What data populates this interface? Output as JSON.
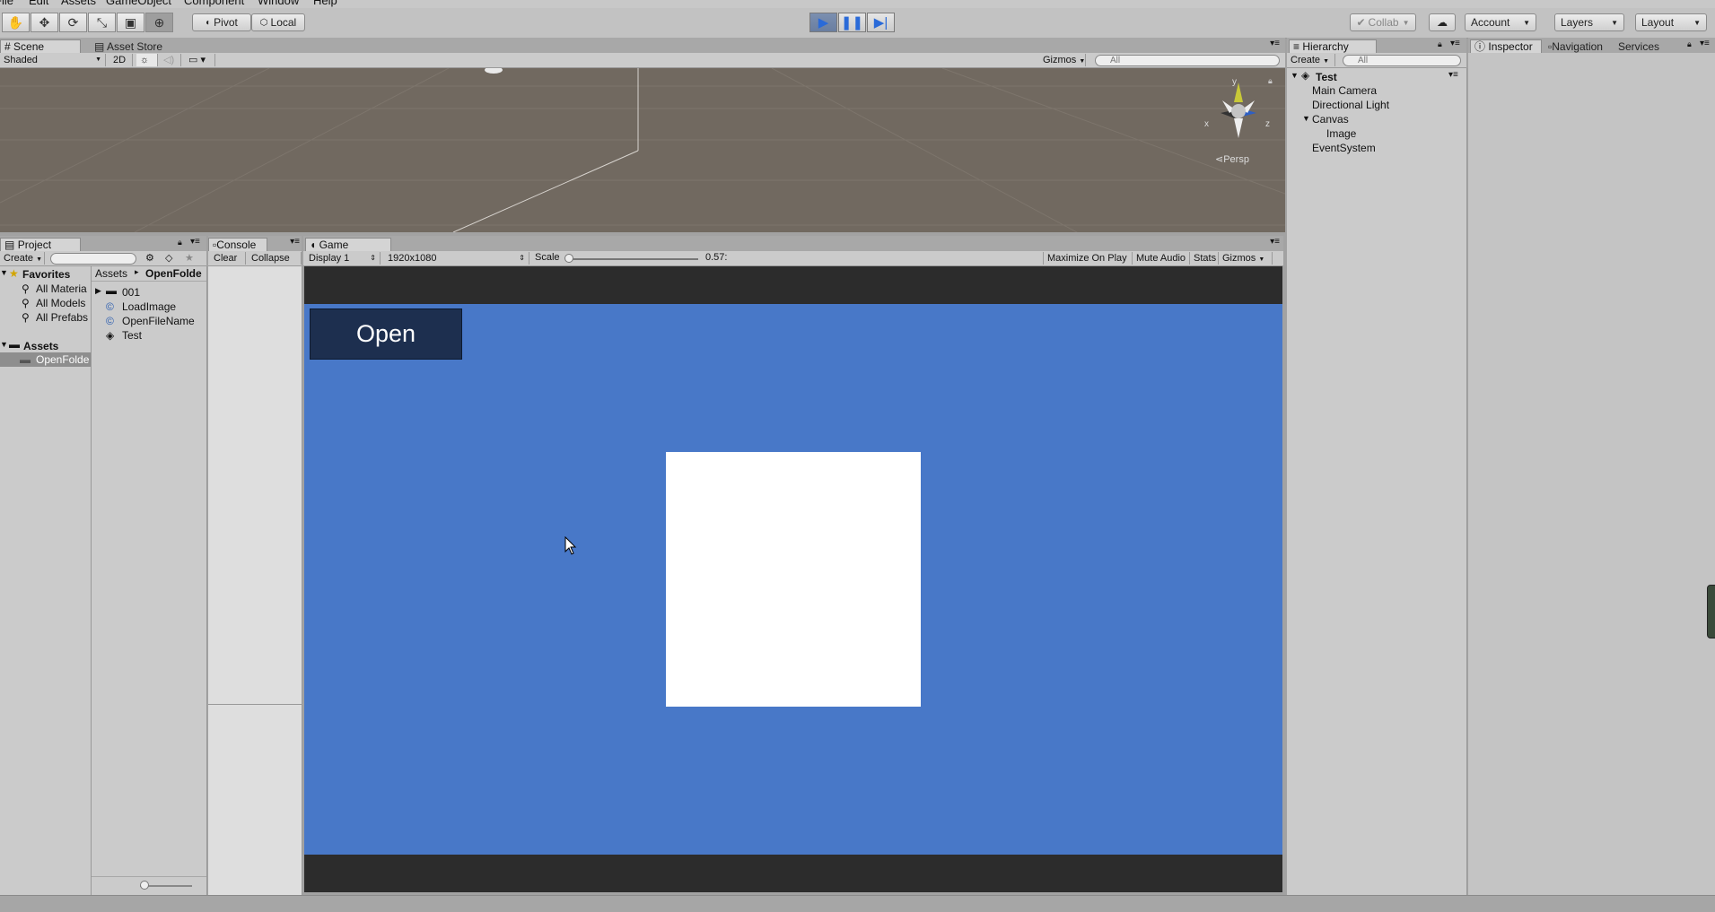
{
  "menu": [
    "File",
    "Edit",
    "Assets",
    "GameObject",
    "Component",
    "Window",
    "Help"
  ],
  "toolbar": {
    "pivot": "Pivot",
    "local": "Local",
    "collab": "Collab",
    "account": "Account",
    "layers": "Layers",
    "layout": "Layout"
  },
  "scene": {
    "tab": "Scene",
    "asset_store_tab": "Asset Store",
    "shading": "Shaded",
    "mode_2d": "2D",
    "gizmos": "Gizmos",
    "search_placeholder": "All",
    "persp": "Persp",
    "axis_y": "y",
    "axis_x": "x",
    "axis_z": "z"
  },
  "project": {
    "tab": "Project",
    "create": "Create",
    "favorites_label": "Favorites",
    "favorites": [
      "All Materia",
      "All Models",
      "All Prefabs"
    ],
    "assets_label": "Assets",
    "selected_folder": "OpenFolde",
    "breadcrumb_root": "Assets",
    "breadcrumb_current": "OpenFolde",
    "files": [
      "001",
      "LoadImage",
      "OpenFileName",
      "Test"
    ]
  },
  "console": {
    "tab": "Console",
    "clear": "Clear",
    "collapse": "Collapse"
  },
  "game": {
    "tab": "Game",
    "display": "Display 1",
    "resolution": "1920x1080",
    "scale_label": "Scale",
    "scale_value": "0.57:",
    "maximize": "Maximize On Play",
    "mute": "Mute Audio",
    "stats": "Stats",
    "gizmos": "Gizmos",
    "open_button": "Open"
  },
  "hierarchy": {
    "tab": "Hierarchy",
    "create": "Create",
    "search_placeholder": "All",
    "scene_name": "Test",
    "items": [
      "Main Camera",
      "Directional Light",
      "Canvas",
      "Image",
      "EventSystem"
    ]
  },
  "inspector": {
    "tab": "Inspector",
    "navigation_tab": "Navigation",
    "services_tab": "Services"
  },
  "colors": {
    "game_background": "#4878c8",
    "open_button": "#1d2f4f",
    "scene_background": "#716960"
  }
}
